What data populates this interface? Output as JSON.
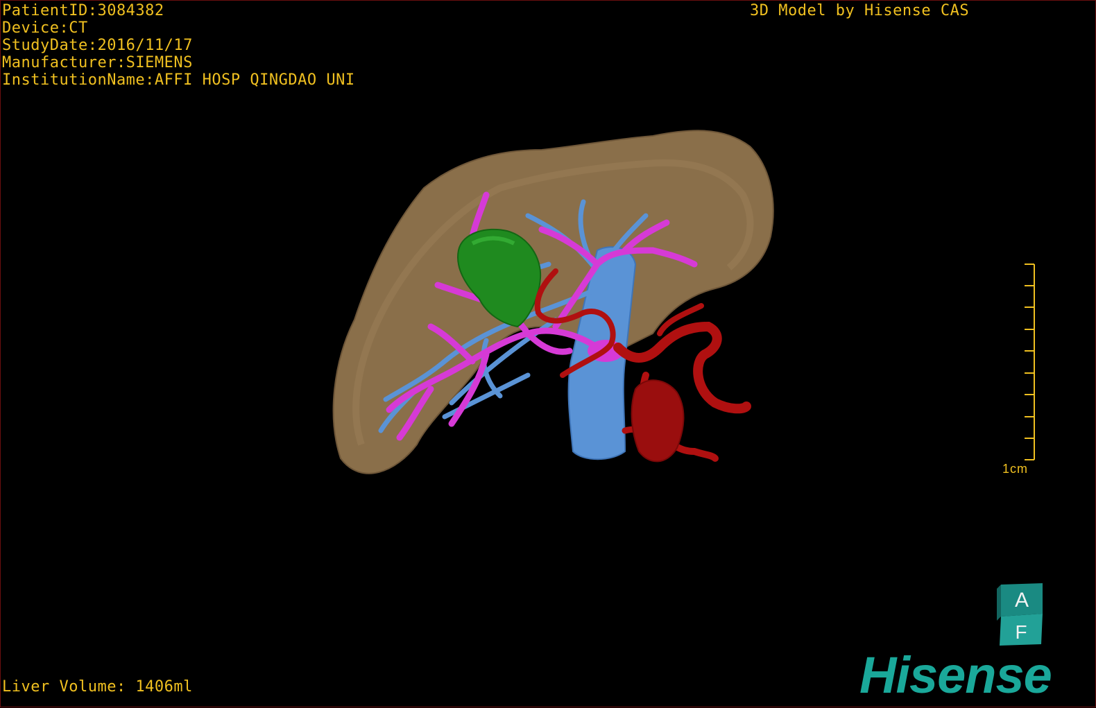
{
  "header_info": {
    "patient_id": "PatientID:3084382",
    "device": "Device:CT",
    "study_date": "StudyDate:2016/11/17",
    "manufacturer": "Manufacturer:SIEMENS",
    "institution": "InstitutionName:AFFI HOSP QINGDAO UNI"
  },
  "title": "3D Model by Hisense CAS",
  "liver_volume": "Liver Volume: 1406ml",
  "scale_bar": {
    "label": "1cm",
    "color": "#f0c020"
  },
  "orientation_cube": {
    "top_face": "A",
    "front_face": "F",
    "color": "#1a8a82"
  },
  "brand": {
    "logo_text": "Hisense",
    "color": "#1aa89a"
  },
  "structure_colors": {
    "liver": "#8a6f4a",
    "tumor": "#1f8a1f",
    "portal_vein": "#d63ad6",
    "hepatic_vein": "#5a93d6",
    "artery": "#b01010"
  }
}
